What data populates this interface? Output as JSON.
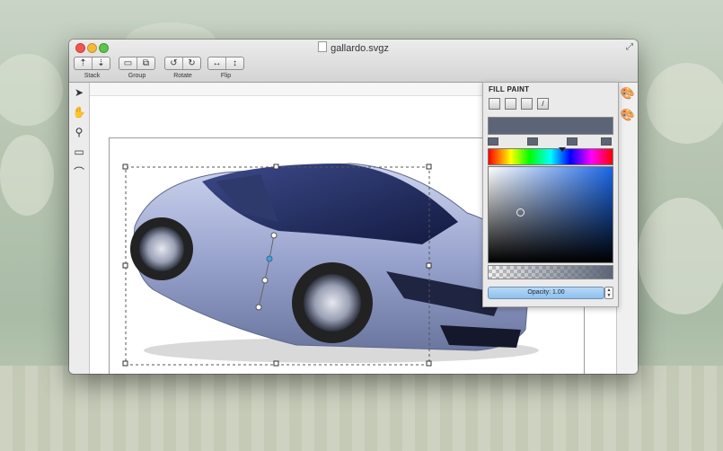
{
  "window": {
    "title": "gallardo.svgz"
  },
  "toolbar": {
    "groups": [
      {
        "label": "Stack",
        "buttons": [
          "⇡",
          "⇣"
        ]
      },
      {
        "label": "Group",
        "buttons": [
          "▭",
          "⧉"
        ]
      },
      {
        "label": "Rotate",
        "buttons": [
          "↺",
          "↻"
        ]
      },
      {
        "label": "Flip",
        "buttons": [
          "↔",
          "↕"
        ]
      }
    ]
  },
  "tools": [
    {
      "name": "pointer-tool-icon",
      "glyph": "➤"
    },
    {
      "name": "hand-tool-icon",
      "glyph": "✋"
    },
    {
      "name": "zoom-tool-icon",
      "glyph": "⚲"
    },
    {
      "name": "rectangle-tool-icon",
      "glyph": "▭"
    },
    {
      "name": "pen-tool-icon",
      "glyph": "⌒"
    }
  ],
  "fill_panel": {
    "title": "FILL PAINT",
    "opacity_label": "Opacity: 1.00",
    "current_color": "#5b6577"
  },
  "colors": {
    "accent": "#8ec0ee",
    "car_body": "#aab4d8",
    "selection_handle": "#4aa0d8"
  }
}
